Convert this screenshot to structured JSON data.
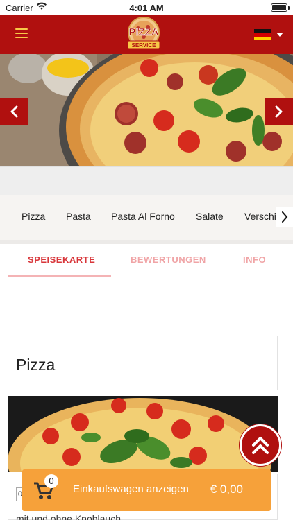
{
  "status_bar": {
    "carrier": "Carrier",
    "time": "4:01 AM"
  },
  "header": {
    "menu_icon": "hamburger-menu-icon",
    "logo_text": "PIZZA SERVICE",
    "logo_line_small": "CITY",
    "flag": "germany-flag",
    "accent": "#b0100f"
  },
  "hero": {
    "image": "pizza-banner-photo",
    "prev_icon": "chevron-left-icon",
    "next_icon": "chevron-right-icon"
  },
  "categories": [
    "Pizza",
    "Pasta",
    "Pasta Al Forno",
    "Salate",
    "Verschi"
  ],
  "tabs": [
    {
      "label": "SPEISEKARTE",
      "active": true
    },
    {
      "label": "BEWERTUNGEN",
      "active": false
    },
    {
      "label": "INFO",
      "active": false
    }
  ],
  "section": {
    "title": "Pizza"
  },
  "item": {
    "quantity": "0",
    "description": "mit und ohne Knoblauch"
  },
  "cart": {
    "count": "0",
    "label": "Einkaufswagen anzeigen",
    "total": "€ 0,00",
    "color": "#f6a13a"
  },
  "scroll_top_icon": "double-chevron-up-icon"
}
